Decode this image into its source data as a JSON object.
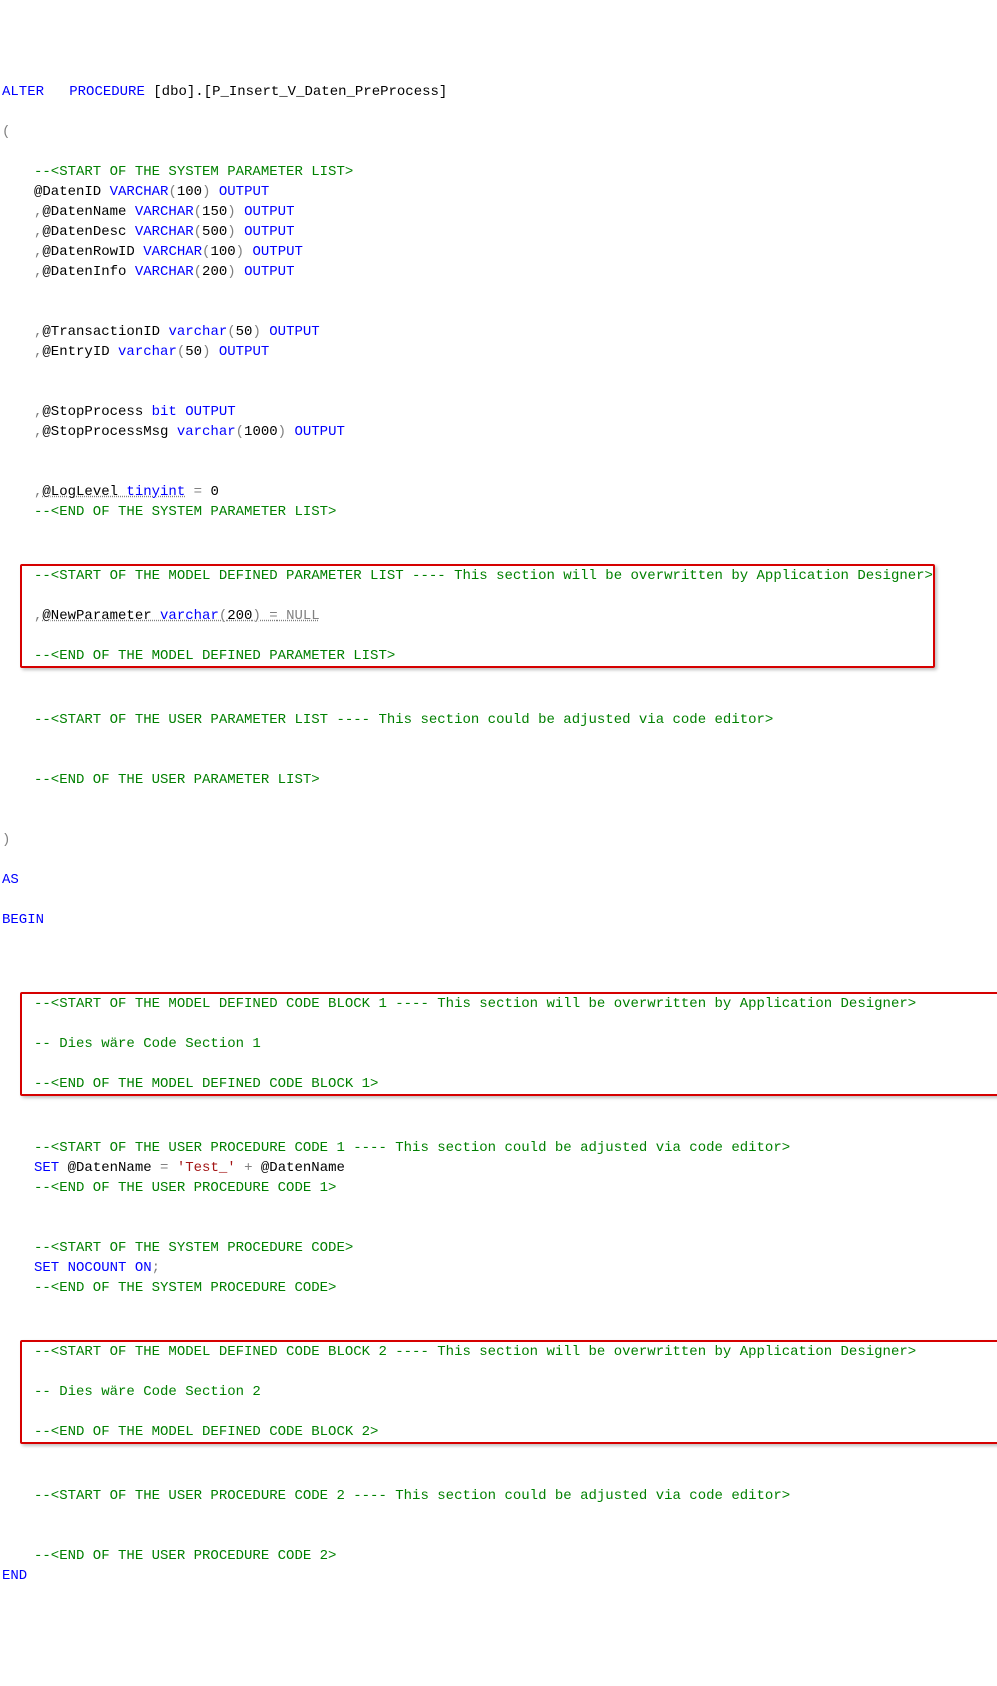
{
  "l1_alter": "ALTER",
  "l1_proc": "PROCEDURE",
  "l1_name": " [dbo].[P_Insert_V_Daten_PreProcess]",
  "l2": "(",
  "c_sysparam_start": "--<START OF THE SYSTEM PARAMETER LIST>",
  "p1_a": "@DatenID ",
  "p1_b": "VARCHAR",
  "p1_c": "100",
  "p1_d": "OUTPUT",
  "p2_a": ",@DatenName ",
  "p2_b": "VARCHAR",
  "p2_c": "150",
  "p2_d": "OUTPUT",
  "p3_a": ",@DatenDesc ",
  "p3_b": "VARCHAR",
  "p3_c": "500",
  "p3_d": "OUTPUT",
  "p4_a": ",@DatenRowID ",
  "p4_b": "VARCHAR",
  "p4_c": "100",
  "p4_d": "OUTPUT",
  "p5_a": ",@DatenInfo ",
  "p5_b": "VARCHAR",
  "p5_c": "200",
  "p5_d": "OUTPUT",
  "p6_a": ",@TransactionID ",
  "p6_b": "varchar",
  "p6_c": "50",
  "p6_d": "OUTPUT",
  "p7_a": ",@EntryID ",
  "p7_b": "varchar",
  "p7_c": "50",
  "p7_d": "OUTPUT",
  "p8_a": ",@StopProcess ",
  "p8_b": "bit",
  "p8_d": "OUTPUT",
  "p9_a": ",@StopProcessMsg ",
  "p9_b": "varchar",
  "p9_c": "1000",
  "p9_d": "OUTPUT",
  "p10_a": ",@LogLevel ",
  "p10_b": "tinyint",
  "p10_eq": " =",
  "p10_val": " 0",
  "c_sysparam_end": "--<END OF THE SYSTEM PARAMETER LIST>",
  "c_model_param_start": "--<START OF THE MODEL DEFINED PARAMETER LIST ---- This section will be overwritten by Application Designer>",
  "np_a": ",@NewParameter ",
  "np_b": "varchar",
  "np_c": "200",
  "np_eq": " =",
  "np_null": " NULL",
  "c_model_param_end": "--<END OF THE MODEL DEFINED PARAMETER LIST>",
  "c_user_param_start": "--<START OF THE USER PARAMETER LIST ---- This section could be adjusted via code editor>",
  "c_user_param_end": "--<END OF THE USER PARAMETER LIST>",
  "rparen": ")",
  "as": "AS",
  "begin": "BEGIN",
  "c_block1_start": "--<START OF THE MODEL DEFINED CODE BLOCK 1 ---- This section will be overwritten by Application Designer>",
  "c_block1_body": "-- Dies wäre Code Section 1",
  "c_block1_end": "--<END OF THE MODEL DEFINED CODE BLOCK 1>",
  "c_userproc1_start": "--<START OF THE USER PROCEDURE CODE 1 ---- This section could be adjusted via code editor>",
  "set1_set": "SET",
  "set1_var": " @DatenName ",
  "set1_eq": "=",
  "set1_str": " 'Test_' ",
  "set1_plus": "+",
  "set1_var2": " @DatenName",
  "c_userproc1_end": "--<END OF THE USER PROCEDURE CODE 1>",
  "c_sysproc_start": "--<START OF THE SYSTEM PROCEDURE CODE>",
  "set2_set": "SET",
  "set2_b": " NOCOUNT ",
  "set2_on": "ON",
  "set2_semi": ";",
  "c_sysproc_end": "--<END OF THE SYSTEM PROCEDURE CODE>",
  "c_block2_start": "--<START OF THE MODEL DEFINED CODE BLOCK 2 ---- This section will be overwritten by Application Designer>",
  "c_block2_body": "-- Dies wäre Code Section 2",
  "c_block2_end": "--<END OF THE MODEL DEFINED CODE BLOCK 2>",
  "c_userproc2_start": "--<START OF THE USER PROCEDURE CODE 2 ---- This section could be adjusted via code editor>",
  "c_userproc2_end": "--<END OF THE USER PROCEDURE CODE 2>",
  "end": "END"
}
